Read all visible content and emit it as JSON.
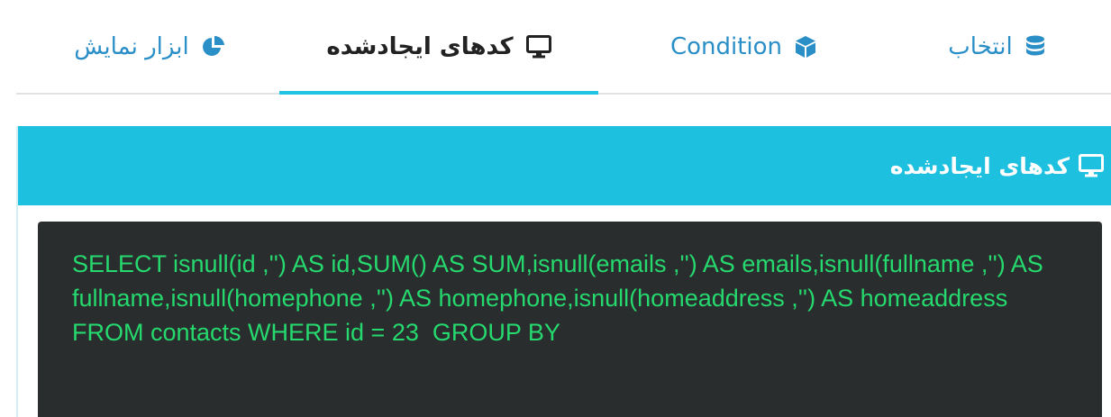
{
  "tabs": [
    {
      "id": "select",
      "label": "انتخاب",
      "icon": "database-icon",
      "active": false
    },
    {
      "id": "condition",
      "label": "Condition",
      "icon": "cube-icon",
      "active": false
    },
    {
      "id": "generated-code",
      "label": "کدهای ایجادشده",
      "icon": "desktop-icon",
      "active": true
    },
    {
      "id": "visualization",
      "label": "ابزار نمایش",
      "icon": "pie-chart-icon",
      "active": false
    }
  ],
  "panel": {
    "title": "کدهای ایجادشده",
    "icon": "desktop-icon",
    "code": "SELECT isnull(id ,'') AS id,SUM() AS SUM,isnull(emails ,'') AS emails,isnull(fullname ,'') AS fullname,isnull(homephone ,'') AS homephone,isnull(homeaddress ,'') AS homeaddress FROM contacts WHERE id = 23  GROUP BY"
  },
  "colors": {
    "accent": "#1ec0e0",
    "link": "#2b8fc7",
    "code_bg": "#2a2d2e",
    "code_text": "#25d96e"
  }
}
